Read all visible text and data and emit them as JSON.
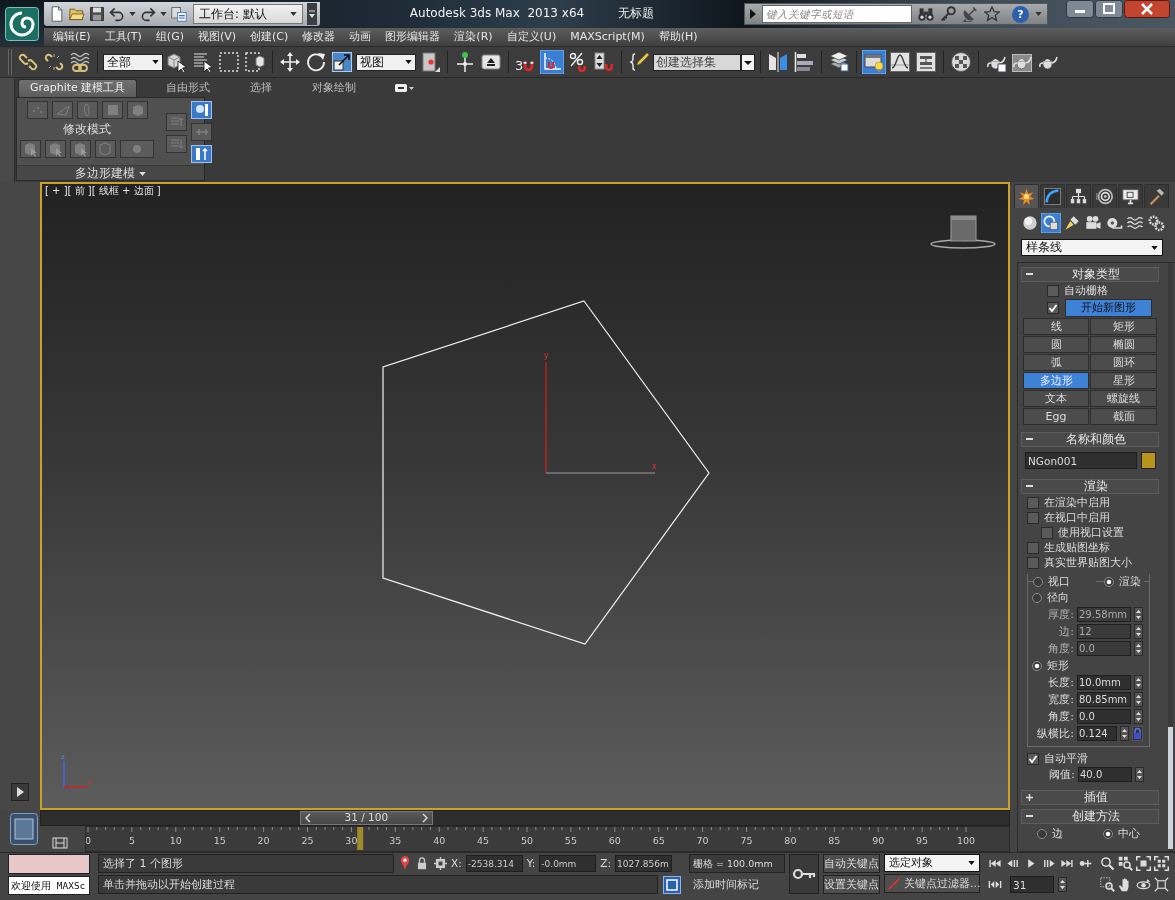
{
  "title_bar": {
    "workspace": "工作台: 默认",
    "app_title": "Autodesk 3ds Max  2013 x64",
    "document_title": "无标题",
    "search": {
      "placeholder": "键入关键字或短语"
    },
    "help": "?"
  },
  "menu": [
    "编辑(E)",
    "工具(T)",
    "组(G)",
    "视图(V)",
    "创建(C)",
    "修改器",
    "动画",
    "图形编辑器",
    "渲染(R)",
    "自定义(U)",
    "MAXScript(M)",
    "帮助(H)"
  ],
  "main_toolbar": [
    [
      {
        "kind": "icon",
        "pressed": false
      },
      {
        "kind": "icon",
        "pressed": false
      },
      {
        "kind": "icon",
        "pressed": false
      }
    ],
    [
      {
        "kind": "dropdown",
        "value": "全部"
      },
      {
        "kind": "icon",
        "pressed": false
      },
      {
        "kind": "icon",
        "pressed": false
      },
      {
        "kind": "icon",
        "pressed": false
      },
      {
        "kind": "icon",
        "pressed": false
      }
    ],
    [
      {
        "kind": "icon",
        "pressed": false
      },
      {
        "kind": "icon",
        "pressed": false
      },
      {
        "kind": "icon",
        "pressed": false
      },
      {
        "kind": "dropdown",
        "value": "视图"
      },
      {
        "kind": "icon",
        "pressed": false
      }
    ],
    [
      {
        "kind": "icon",
        "pressed": false
      },
      {
        "kind": "icon",
        "pressed": false
      }
    ],
    [
      {
        "kind": "snap",
        "label": "3",
        "pressed": false
      },
      {
        "kind": "icon",
        "pressed": true
      },
      {
        "kind": "icon",
        "pressed": false
      },
      {
        "kind": "icon",
        "pressed": false
      }
    ],
    [
      {
        "kind": "icon",
        "pressed": false
      },
      {
        "kind": "combo",
        "placeholder": "创建选择集"
      }
    ],
    [
      {
        "kind": "icon",
        "pressed": false
      },
      {
        "kind": "icon",
        "pressed": false
      }
    ],
    [
      {
        "kind": "icon",
        "pressed": false
      }
    ],
    [
      {
        "kind": "icon",
        "pressed": true
      },
      {
        "kind": "icon",
        "pressed": false
      },
      {
        "kind": "icon",
        "pressed": false
      }
    ],
    [
      {
        "kind": "icon",
        "pressed": false
      }
    ],
    [
      {
        "kind": "icon",
        "pressed": false
      },
      {
        "kind": "icon",
        "pressed": false
      },
      {
        "kind": "icon",
        "pressed": false
      }
    ]
  ],
  "ribbon": {
    "tabs": [
      {
        "label": "Graphite 建模工具",
        "selected": true
      },
      {
        "label": "自由形式",
        "selected": false
      },
      {
        "label": "选择",
        "selected": false
      },
      {
        "label": "对象绘制",
        "selected": false
      }
    ],
    "panel": {
      "mode_label": "修改模式",
      "title": "多边形建模"
    }
  },
  "viewport": {
    "label": "[ + ][ 前 ][ 线框 + 边面 ]",
    "active": true,
    "gizmo": {
      "y_label": "y",
      "x_label": "x"
    },
    "tripod": {
      "z_label": "z",
      "x_label": "x"
    }
  },
  "command_panel": {
    "tabs": [
      {
        "selected": true
      },
      {
        "selected": false
      },
      {
        "selected": false
      },
      {
        "selected": false
      },
      {
        "selected": false
      },
      {
        "selected": false
      }
    ],
    "categories": [
      {
        "selected": false
      },
      {
        "selected": true
      },
      {
        "selected": false
      },
      {
        "selected": false
      },
      {
        "selected": false
      },
      {
        "selected": false
      },
      {
        "selected": false
      }
    ],
    "object_category": "样条线",
    "rollouts": [
      {
        "kind": "object_type",
        "title": "对象类型",
        "expanded": true,
        "auto_grid": {
          "label": "自动栅格",
          "checked": false
        },
        "start_new_shape": {
          "label": "开始新图形",
          "checked": true,
          "active": true
        },
        "buttons": [
          {
            "label": "线",
            "selected": false
          },
          {
            "label": "矩形",
            "selected": false
          },
          {
            "label": "圆",
            "selected": false
          },
          {
            "label": "椭圆",
            "selected": false
          },
          {
            "label": "弧",
            "selected": false
          },
          {
            "label": "圆环",
            "selected": false
          },
          {
            "label": "多边形",
            "selected": true
          },
          {
            "label": "星形",
            "selected": false
          },
          {
            "label": "文本",
            "selected": false
          },
          {
            "label": "螺旋线",
            "selected": false
          },
          {
            "label": "Egg",
            "selected": false
          },
          {
            "label": "截面",
            "selected": false
          }
        ]
      },
      {
        "kind": "name_color",
        "title": "名称和颜色",
        "expanded": true,
        "name": "NGon001",
        "color": "#b8951a"
      },
      {
        "kind": "rendering",
        "title": "渲染",
        "expanded": true,
        "options": [
          {
            "label": "在渲染中启用",
            "checked": false
          },
          {
            "label": "在视口中启用",
            "checked": false,
            "children": [
              {
                "label": "使用视口设置",
                "checked": false
              }
            ]
          },
          {
            "label": "生成贴图坐标",
            "checked": false
          },
          {
            "label": "真实世界贴图大小",
            "checked": false
          }
        ],
        "modes": [
          {
            "label": "视口",
            "selected": false
          },
          {
            "label": "渲染",
            "selected": true
          }
        ],
        "profiles": [
          {
            "label": "径向",
            "selected": false,
            "fields": [
              {
                "label": "厚度:",
                "value": "29.58mm"
              },
              {
                "label": "边:",
                "value": "12"
              },
              {
                "label": "角度:",
                "value": "0.0"
              }
            ]
          },
          {
            "label": "矩形",
            "selected": true,
            "fields": [
              {
                "label": "长度:",
                "value": "10.0mm"
              },
              {
                "label": "宽度:",
                "value": "80.85mm"
              },
              {
                "label": "角度:",
                "value": "0.0"
              },
              {
                "label": "纵横比:",
                "value": "0.124",
                "lock": true
              }
            ]
          }
        ],
        "auto_smooth": {
          "label": "自动平滑",
          "checked": true
        },
        "threshold": {
          "label": "阈值:",
          "value": "40.0"
        }
      },
      {
        "title": "插值",
        "expanded": false
      },
      {
        "kind": "creation_method",
        "title": "创建方法",
        "expanded": true,
        "options": [
          {
            "label": "边",
            "selected": false
          },
          {
            "label": "中心",
            "selected": true
          }
        ]
      }
    ]
  },
  "time_slider": {
    "reading": "31 / 100",
    "level": 0.31
  },
  "track_bar": {
    "labels": [
      "0",
      "5",
      "10",
      "15",
      "20",
      "25",
      "30",
      "35",
      "40",
      "45",
      "50",
      "55",
      "60",
      "65",
      "70",
      "75",
      "80",
      "85",
      "90",
      "95",
      "100"
    ],
    "level": 0.31
  },
  "status_bar": {
    "listener_output": "欢迎使用 MAXSc",
    "selection": "选择了 1 个图形",
    "prompt": "单击并拖动以开始创建过程",
    "coordinates": [
      {
        "axis": "X:",
        "value": "-2538.314"
      },
      {
        "axis": "Y:",
        "value": "-0.0mm"
      },
      {
        "axis": "Z:",
        "value": "1027.856m"
      }
    ],
    "grid": "栅格 = 100.0mm",
    "time_tag": "添加时间标记",
    "auto_key": {
      "label": "自动关键点",
      "on": false
    },
    "set_key": "设置关键点",
    "key_set": "选定对象",
    "key_filters": "关键点过滤器...",
    "current_frame": "31"
  }
}
